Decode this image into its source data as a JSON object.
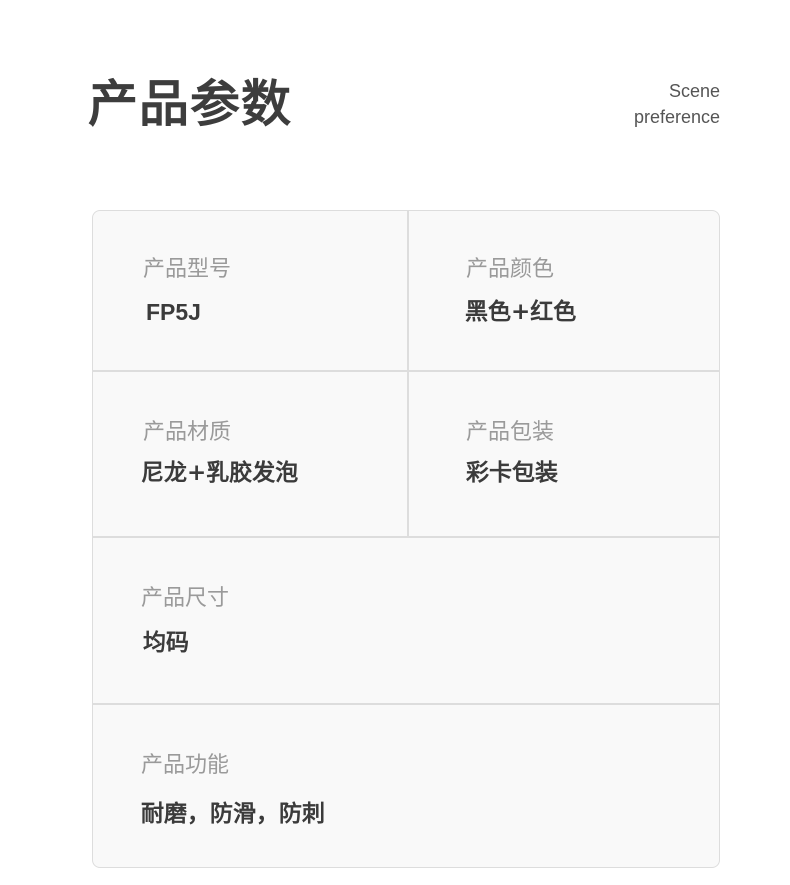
{
  "header": {
    "title": "产品参数",
    "subtitle_line1": "Scene",
    "subtitle_line2": "preference"
  },
  "specs": [
    {
      "label": "产品型号",
      "value": "FP5J"
    },
    {
      "label": "产品颜色",
      "value": "黑色+红色"
    },
    {
      "label": "产品材质",
      "value": "尼龙+乳胶发泡"
    },
    {
      "label": "产品包装",
      "value": "彩卡包装"
    },
    {
      "label": "产品尺寸",
      "value": "均码"
    },
    {
      "label": "产品功能",
      "value": "耐磨，防滑，防刺"
    }
  ]
}
